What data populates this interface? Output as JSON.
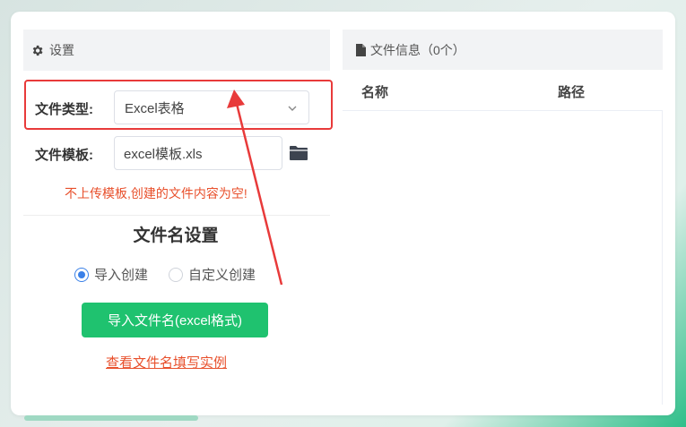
{
  "settings": {
    "header_title": "设置",
    "file_type_label": "文件类型:",
    "file_type_value": "Excel表格",
    "template_label": "文件模板:",
    "template_value": "excel模板.xls",
    "warning": "不上传模板,创建的文件内容为空!",
    "filename_section_title": "文件名设置",
    "radio_options": [
      {
        "label": "导入创建",
        "selected": true
      },
      {
        "label": "自定义创建",
        "selected": false
      }
    ],
    "import_button": "导入文件名(excel格式)",
    "example_link": "查看文件名填写实例"
  },
  "file_info": {
    "header_title": "文件信息（0个）",
    "columns": [
      "名称",
      "路径"
    ]
  },
  "colors": {
    "accent_green": "#1fc26f",
    "warning_orange": "#e8502c",
    "highlight_red": "#e83a3a",
    "radio_blue": "#3a80e8"
  },
  "icons": {
    "settings": "gear-icon",
    "select_caret": "chevron-down-icon",
    "template_browse": "folder-icon",
    "file_info": "file-icon"
  }
}
